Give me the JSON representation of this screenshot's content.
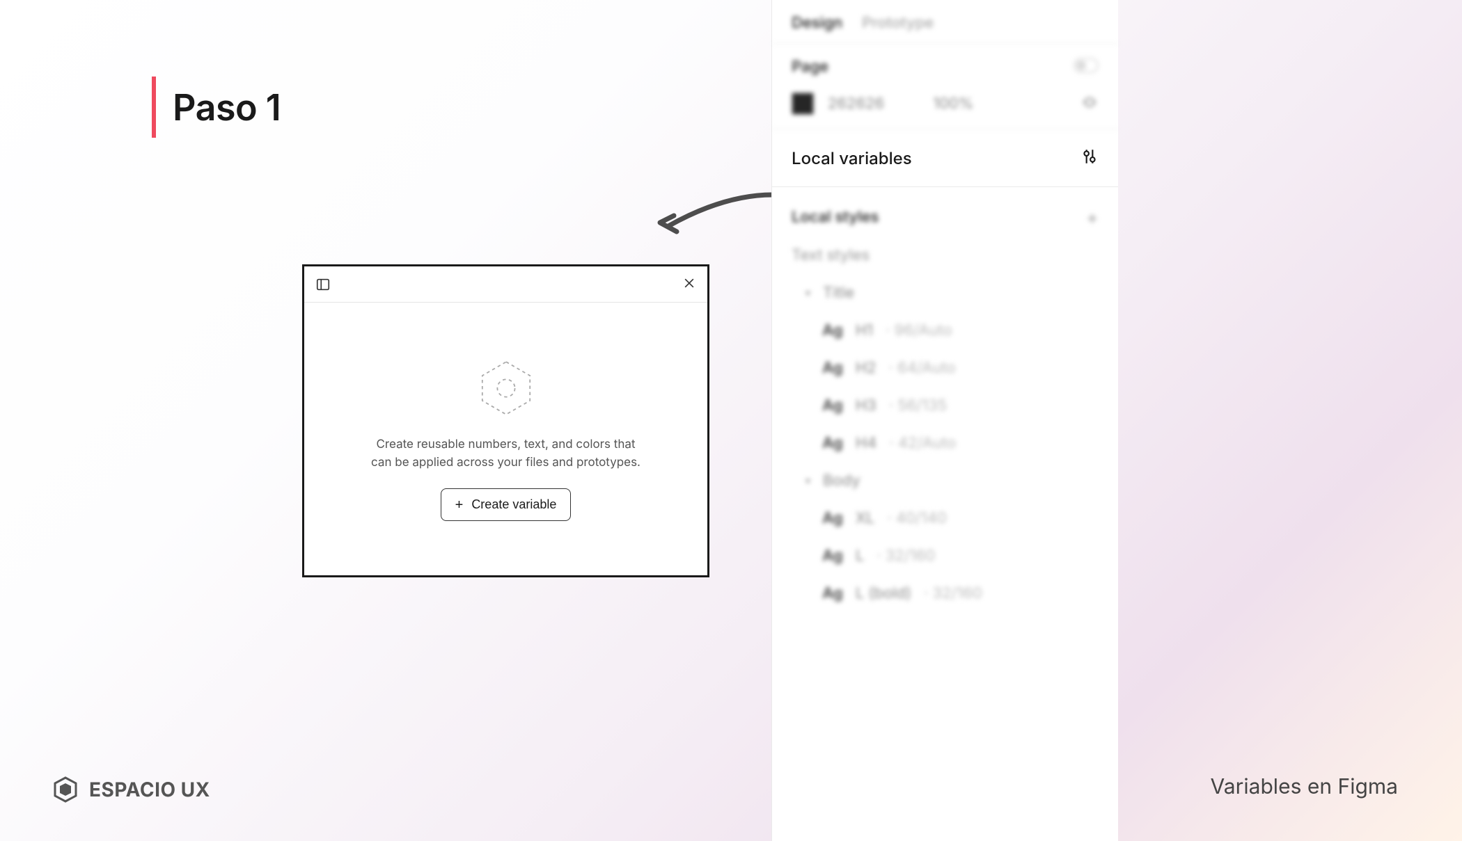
{
  "slide": {
    "step_title": "Paso 1",
    "logo_text": "ESPACIO UX",
    "footer_caption": "Variables en Figma"
  },
  "modal": {
    "description": "Create reusable numbers, text, and colors that can be applied across your files and prototypes.",
    "button_label": "Create variable"
  },
  "panel": {
    "tabs": {
      "design": "Design",
      "prototype": "Prototype"
    },
    "page": {
      "label": "Page",
      "hex": "262626",
      "opacity": "100%"
    },
    "local_variables": {
      "title": "Local variables"
    },
    "local_styles": {
      "title": "Local styles",
      "text_styles_label": "Text styles",
      "groups": [
        {
          "name": "Title",
          "items": [
            {
              "name": "H1",
              "size": "96/Auto"
            },
            {
              "name": "H2",
              "size": "64/Auto"
            },
            {
              "name": "H3",
              "size": "56/135"
            },
            {
              "name": "H4",
              "size": "42/Auto"
            }
          ]
        },
        {
          "name": "Body",
          "items": [
            {
              "name": "XL",
              "size": "40/140"
            },
            {
              "name": "L",
              "size": "32/160"
            },
            {
              "name": "L (bold)",
              "size": "32/160"
            }
          ]
        }
      ]
    }
  }
}
